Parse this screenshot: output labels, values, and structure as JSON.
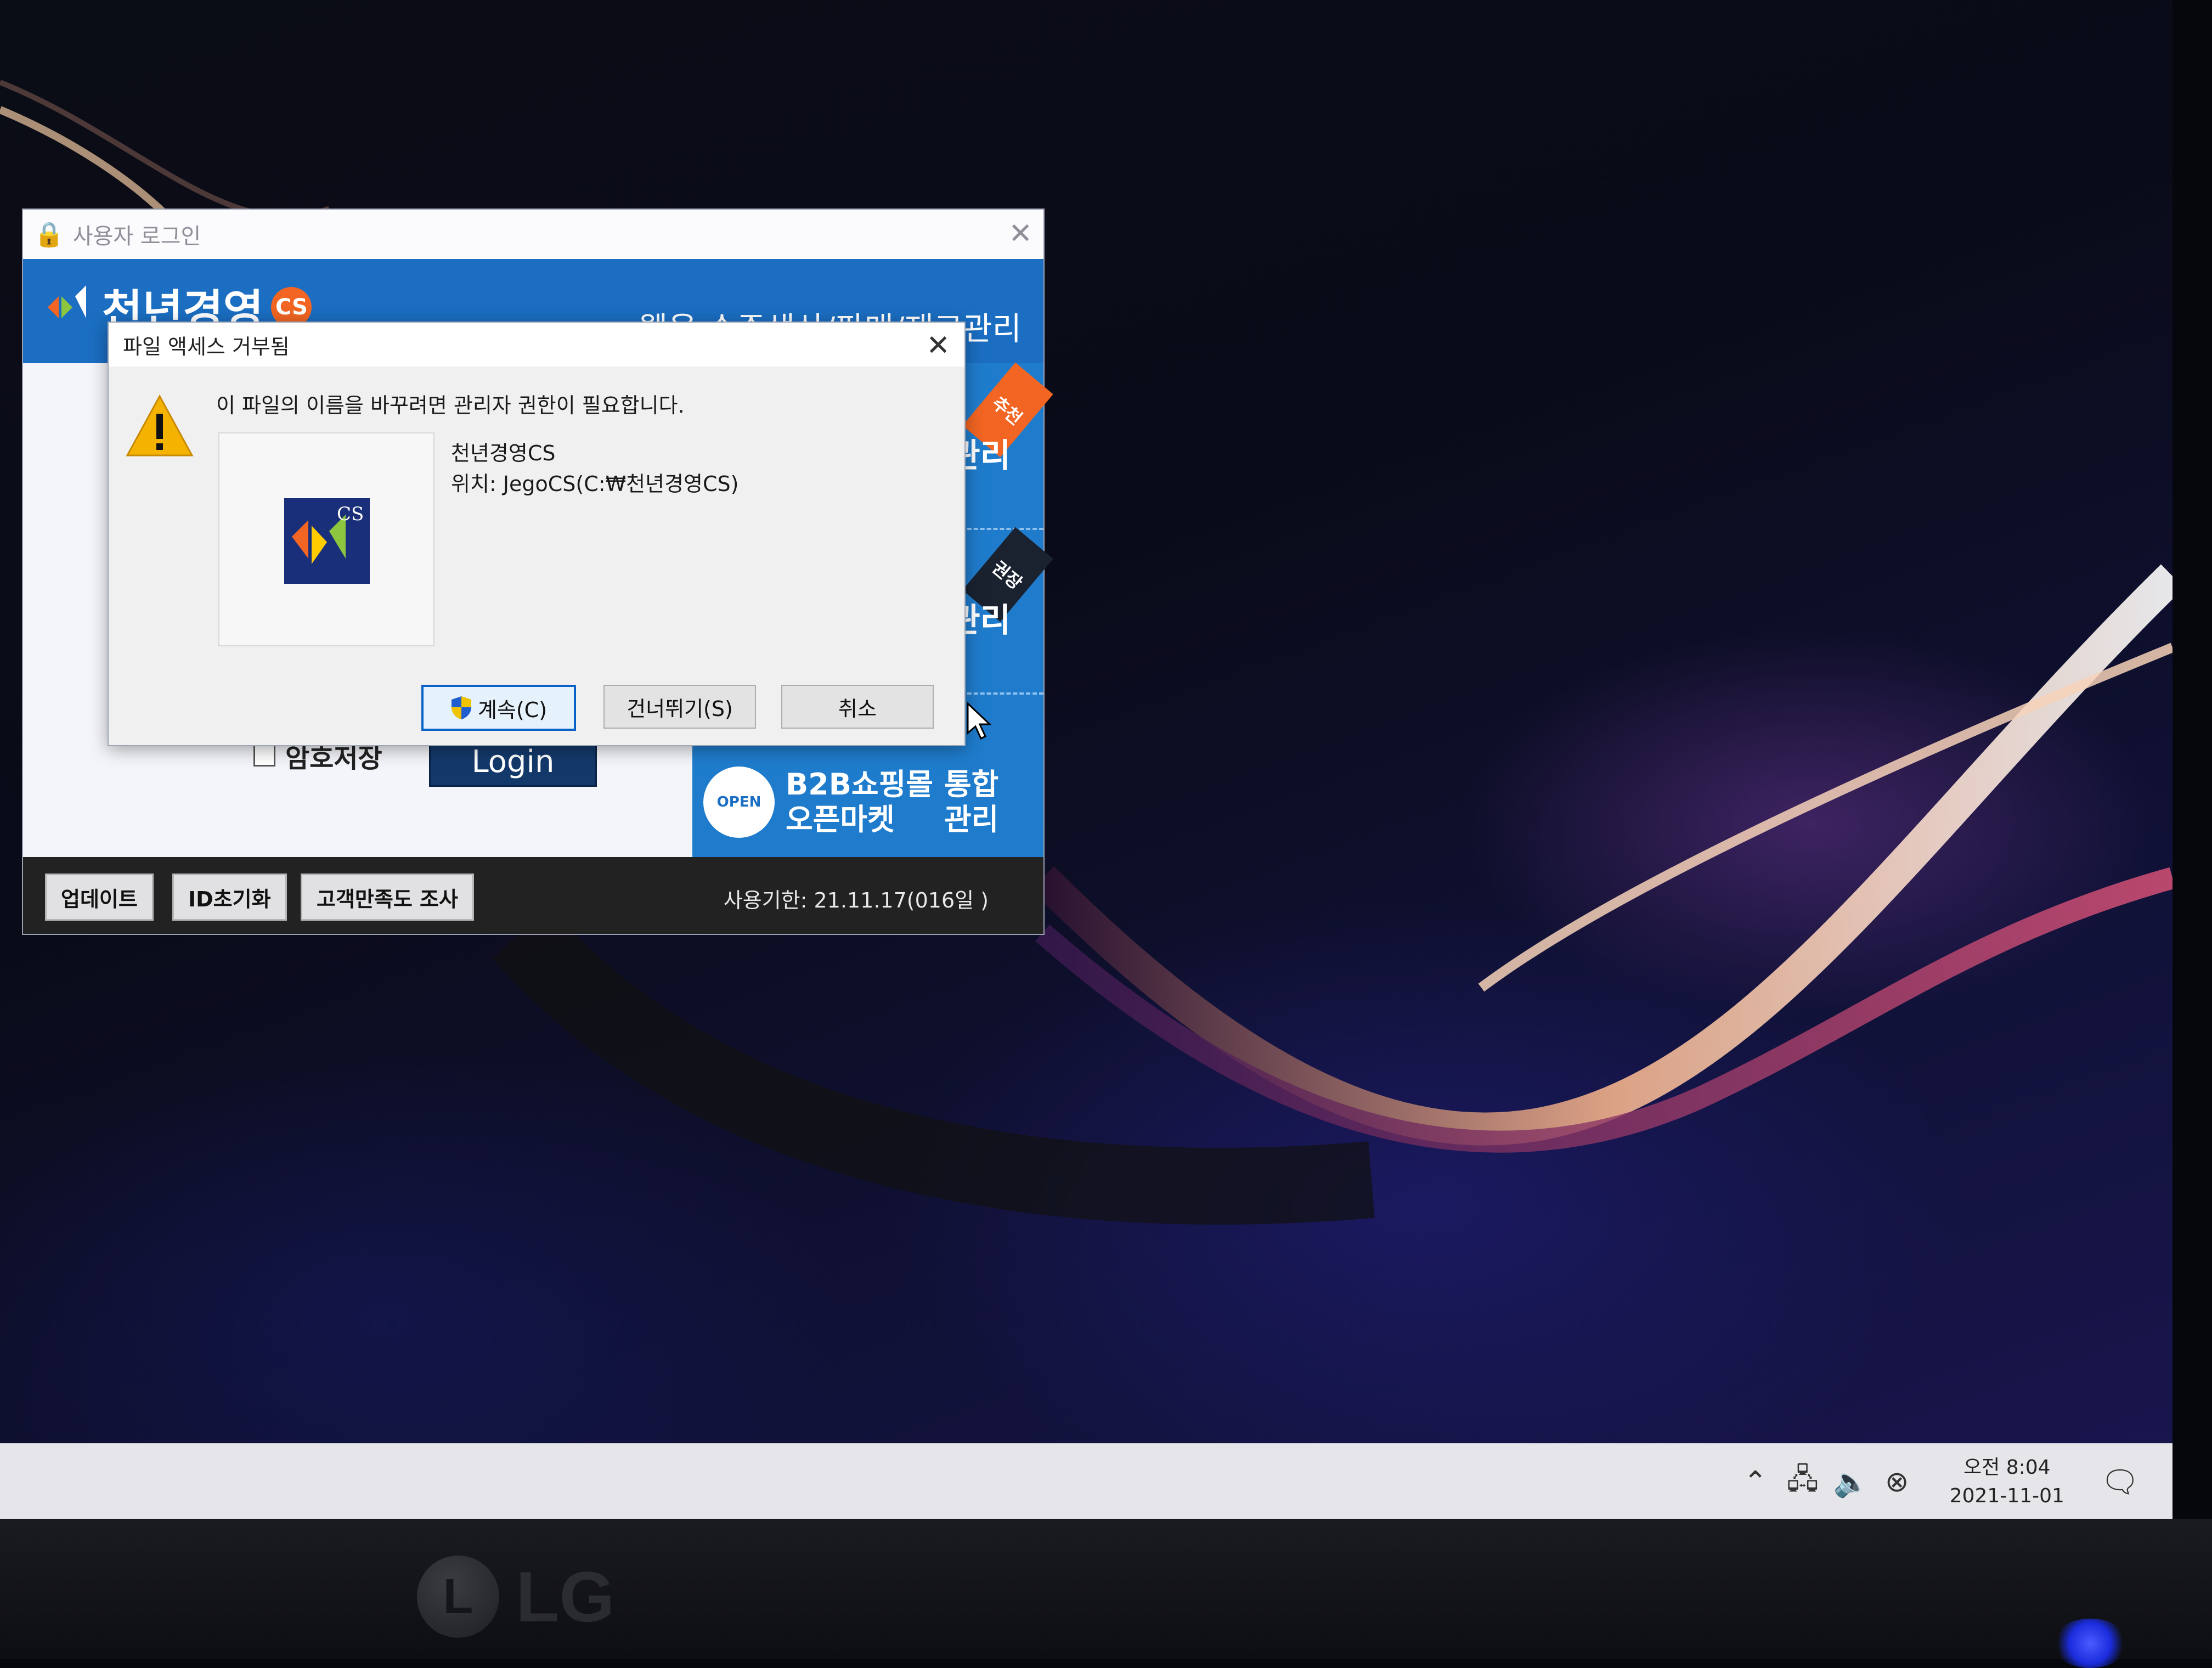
{
  "login_window": {
    "title": "사용자 로그인",
    "brand_name": "천년경영",
    "brand_badge": "CS",
    "banner_text": "웹용 수주생산/판매/재고관리",
    "side_items": [
      {
        "ribbon": "추천",
        "label": "관리"
      },
      {
        "ribbon": "권장",
        "label": "관리"
      }
    ],
    "b2b_label": "B2B쇼핑몰",
    "b2b_sub": "오픈마켓",
    "b2b_right_1": "통합",
    "b2b_right_2": "관리",
    "open_badge": "OPEN",
    "password_save": "암호저장",
    "login_button": "Login",
    "footer": {
      "update_button": "업데이트",
      "id_reset_button": "ID초기화",
      "survey_button": "고객만족도 조사",
      "expiry": "사용기한: 21.11.17(016일 )"
    }
  },
  "dialog": {
    "title": "파일 액세스 거부됨",
    "message": "이 파일의 이름을 바꾸려면 관리자 권한이 필요합니다.",
    "file_name": "천년경영CS",
    "file_location": "위치: JegoCS(C:₩천년경영CS)",
    "icon_badge": "CS",
    "buttons": {
      "continue": "계속(C)",
      "skip": "건너뛰기(S)",
      "cancel": "취소"
    }
  },
  "taskbar": {
    "time": "오전 8:04",
    "date": "2021-11-01",
    "tray_icons": [
      "chevron-up-icon",
      "network-icon",
      "volume-icon",
      "ime-icon"
    ]
  },
  "monitor": {
    "brand": "LG"
  }
}
